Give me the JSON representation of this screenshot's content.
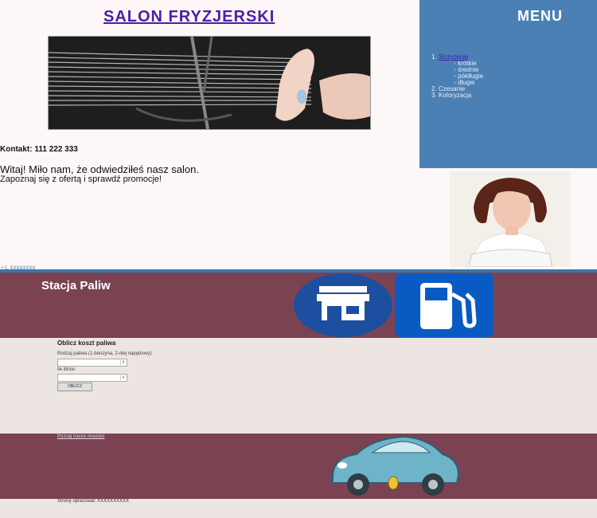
{
  "salon": {
    "title": "SALON FRYZJERSKI",
    "contact": "Kontakt: 111 222 333",
    "welcome_line1": "Witaj! Miło nam, że odwiedziłeś nasz salon.",
    "welcome_line2": "Zapoznaj się z ofertą i sprawdź promocje!",
    "menu": {
      "title": "MENU",
      "items": [
        {
          "number": "1.",
          "label": "Strzyżenie"
        },
        {
          "number": "2.",
          "label": "Czesanie"
        },
        {
          "number": "3.",
          "label": "Koloryzacja"
        }
      ],
      "subitems": [
        "krótkie",
        "średnie",
        "półdługie",
        "długie"
      ]
    },
    "divider_text": "• 1. XXXXXXXX"
  },
  "station": {
    "title": "Stacja Paliw",
    "form": {
      "title": "Oblicz koszt paliwa",
      "fuel_label": "Rodzaj paliwa (1-benzyna, 2-olej napędowy):",
      "liters_label": "ile litrów:",
      "button_label": "OBLICZ"
    },
    "link": "Poznaj nasze nowości",
    "author": "Stronę opracował: XXXXXXXXXX"
  },
  "colors": {
    "salon_title": "#4b1fa8",
    "menu_bg": "#4a80b4",
    "station_band": "#7b4252",
    "station_main": "#ede5e1"
  }
}
